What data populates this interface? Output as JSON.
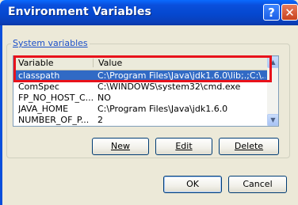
{
  "window": {
    "title": "Environment Variables",
    "help_label": "?",
    "close_label": "✕"
  },
  "system_variables": {
    "group_label": "System variables",
    "columns": [
      "Variable",
      "Value"
    ],
    "rows": [
      {
        "variable": "classpath",
        "value": "C:\\Program Files\\Java\\jdk1.6.0\\lib;.;C:\\...",
        "selected": true
      },
      {
        "variable": "ComSpec",
        "value": "C:\\WINDOWS\\system32\\cmd.exe",
        "selected": false
      },
      {
        "variable": "FP_NO_HOST_C...",
        "value": "NO",
        "selected": false
      },
      {
        "variable": "JAVA_HOME",
        "value": "C:\\Program Files\\Java\\jdk1.6.0",
        "selected": false
      },
      {
        "variable": "NUMBER_OF_P...",
        "value": "2",
        "selected": false
      }
    ],
    "scroll_up": "▲",
    "scroll_down": "▼"
  },
  "buttons": {
    "new": "New",
    "edit": "Edit",
    "delete": "Delete",
    "ok": "OK",
    "cancel": "Cancel"
  },
  "colors": {
    "titlebar": "#0a4fdc",
    "selection": "#316ac5",
    "highlight_box": "#e8121b",
    "dialog_bg": "#ece9d8"
  }
}
